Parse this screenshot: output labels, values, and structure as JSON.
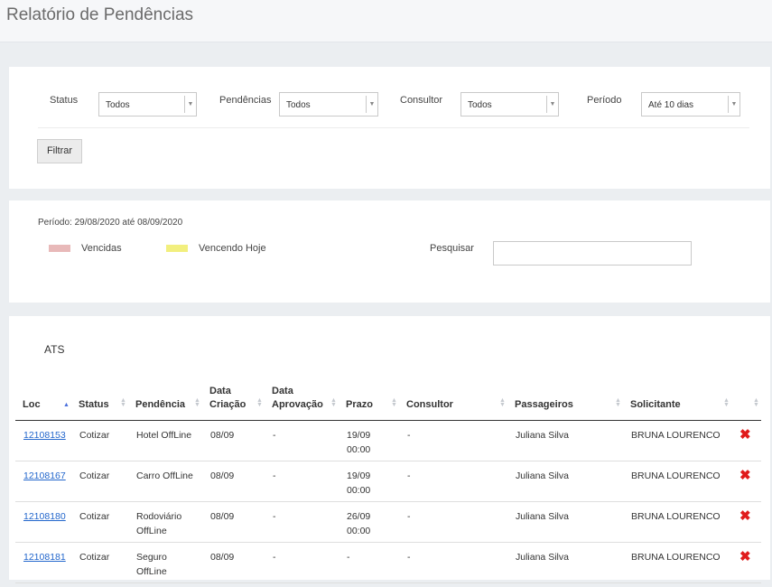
{
  "page": {
    "title": "Relatório de Pendências"
  },
  "filters": {
    "status": {
      "label": "Status",
      "value": "Todos"
    },
    "pendencias": {
      "label": "Pendências",
      "value": "Todos"
    },
    "consultor": {
      "label": "Consultor",
      "value": "Todos"
    },
    "periodo": {
      "label": "Período",
      "value": "Até 10 dias"
    },
    "button": "Filtrar"
  },
  "summary": {
    "periodo": "Período: 29/08/2020 até 08/09/2020",
    "legend": [
      {
        "label": "Vencidas",
        "color": "#e8b9b9"
      },
      {
        "label": "Vencendo Hoje",
        "color": "#f2ef7e"
      }
    ],
    "search_label": "Pesquisar",
    "search_value": ""
  },
  "table": {
    "group": "ATS",
    "columns": [
      "Loc",
      "Status",
      "Pendência",
      "Data Criação",
      "Data Aprovação",
      "Prazo",
      "Consultor",
      "Passageiros",
      "Solicitante",
      ""
    ],
    "sorted_column": "Loc",
    "rows": [
      {
        "loc": "12108153",
        "status": "Cotizar",
        "pendencia": "Hotel OffLine",
        "criacao": "08/09",
        "aprovacao": "-",
        "prazo": "19/09 00:00",
        "consultor": "-",
        "passageiros": "Juliana Silva",
        "solicitante": "BRUNA LOURENCO"
      },
      {
        "loc": "12108167",
        "status": "Cotizar",
        "pendencia": "Carro OffLine",
        "criacao": "08/09",
        "aprovacao": "-",
        "prazo": "19/09 00:00",
        "consultor": "-",
        "passageiros": "Juliana Silva",
        "solicitante": "BRUNA LOURENCO"
      },
      {
        "loc": "12108180",
        "status": "Cotizar",
        "pendencia": "Rodoviário OffLine",
        "criacao": "08/09",
        "aprovacao": "-",
        "prazo": "26/09 00:00",
        "consultor": "-",
        "passageiros": "Juliana Silva",
        "solicitante": "BRUNA LOURENCO"
      },
      {
        "loc": "12108181",
        "status": "Cotizar",
        "pendencia": "Seguro OffLine",
        "criacao": "08/09",
        "aprovacao": "-",
        "prazo": "-",
        "consultor": "-",
        "passageiros": "Juliana Silva",
        "solicitante": "BRUNA LOURENCO"
      }
    ],
    "delete_icon": "close-icon",
    "delete_color": "#e01b1b"
  }
}
